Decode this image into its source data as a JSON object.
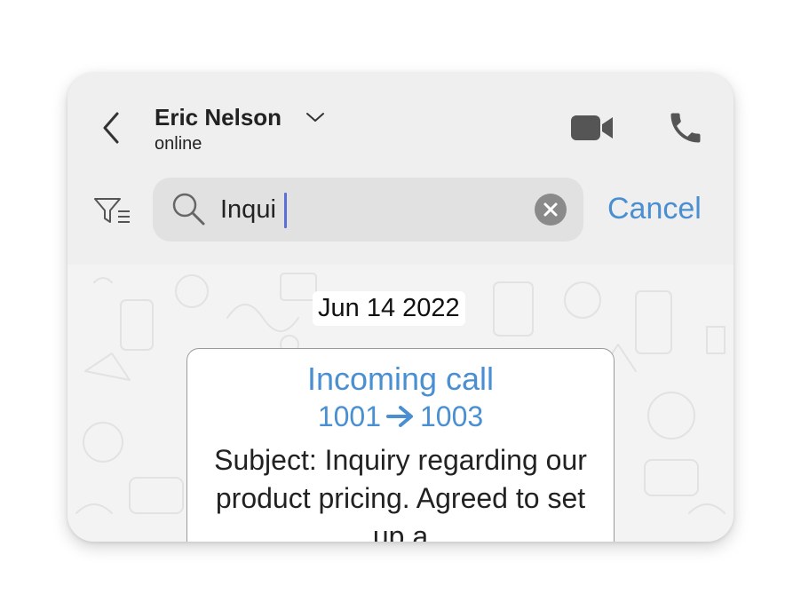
{
  "header": {
    "contact_name": "Eric Nelson",
    "status": "online"
  },
  "search": {
    "query": "Inqui",
    "cancel_label": "Cancel"
  },
  "chat": {
    "date": "Jun 14 2022",
    "message": {
      "title": "Incoming call",
      "from": "1001",
      "to": "1003",
      "body": "Subject: Inquiry regarding our product pricing. Agreed to set up a"
    }
  },
  "colors": {
    "accent": "#4a8fd1",
    "header_bg": "#efefef",
    "search_bg": "#e1e1e1",
    "caret": "#5b6fd8"
  },
  "icons": [
    "back-chevron-icon",
    "chevron-down-icon",
    "video-camera-icon",
    "phone-icon",
    "filter-icon",
    "search-icon",
    "clear-icon",
    "arrow-right-icon"
  ]
}
